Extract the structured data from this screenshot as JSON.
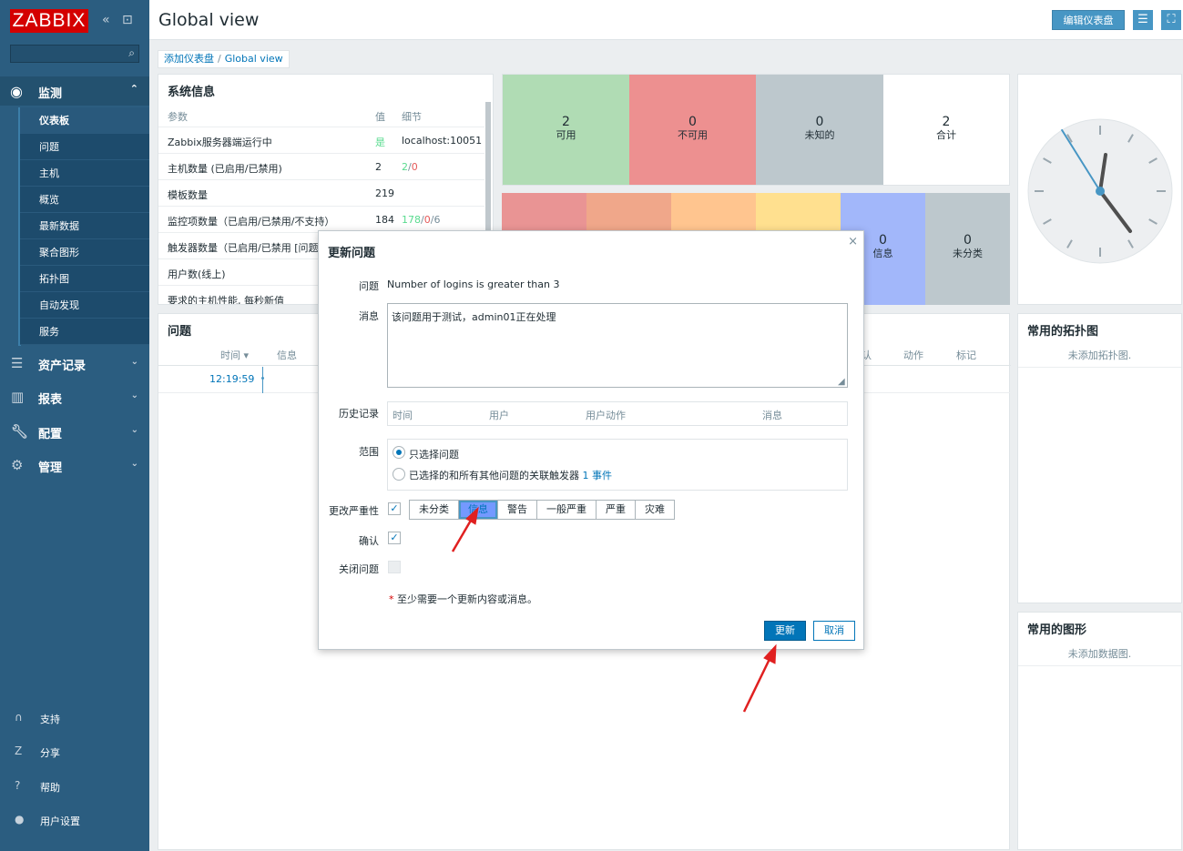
{
  "app": {
    "logo": "ZABBIX",
    "collapse_icon": "double-chevron-left-icon",
    "kiosk_icon": "kiosk-icon"
  },
  "sidebar": {
    "search_placeholder": "",
    "monitoring": {
      "label": "监测",
      "items": [
        "仪表板",
        "问题",
        "主机",
        "概览",
        "最新数据",
        "聚合图形",
        "拓扑图",
        "自动发现",
        "服务"
      ],
      "active": "仪表板"
    },
    "menus": [
      "资产记录",
      "报表",
      "配置",
      "管理"
    ],
    "bottom": [
      "支持",
      "分享",
      "帮助",
      "用户设置"
    ]
  },
  "header": {
    "title": "Global view",
    "edit_button": "编辑仪表盘",
    "colors": {
      "accent": "#4796c4"
    }
  },
  "breadcrumb": {
    "root": "添加仪表盘",
    "sep": "/",
    "current": "Global view"
  },
  "sysinfo": {
    "title": "系统信息",
    "cols": {
      "param": "参数",
      "value": "值",
      "detail": "细节"
    },
    "rows": [
      {
        "param": "Zabbix服务器端运行中",
        "value": "是",
        "detail": "localhost:10051"
      },
      {
        "param": "主机数量 (已启用/已禁用)",
        "value": "2",
        "d1": "2",
        "sep1": "/",
        "d2": "0"
      },
      {
        "param": "模板数量",
        "value": "219"
      },
      {
        "param": "监控项数量（已启用/已禁用/不支持）",
        "value": "184",
        "d1": "178",
        "sep1": "/",
        "d2": "0",
        "sep2": "/",
        "d3": "6"
      },
      {
        "param": "触发器数量（已启用/已禁用 [问题"
      },
      {
        "param": "用户数(线上)"
      },
      {
        "param": "要求的主机性能, 每秒新值"
      }
    ]
  },
  "host_avail": [
    {
      "count": "2",
      "label": "可用",
      "color": "#b0dcb4"
    },
    {
      "count": "0",
      "label": "不可用",
      "color": "#ed9090"
    },
    {
      "count": "0",
      "label": "未知的",
      "color": "#bdc8cd"
    },
    {
      "count": "2",
      "label": "合计",
      "color": "#ffffff"
    }
  ],
  "severity_tiles": [
    {
      "count": "",
      "label": "",
      "color": "#e99494"
    },
    {
      "count": "",
      "label": "",
      "color": "#f0a78a"
    },
    {
      "count": "",
      "label": "",
      "color": "#ffc58f"
    },
    {
      "count": "",
      "label": "",
      "color": "#ffe08f"
    },
    {
      "count": "0",
      "label": "信息",
      "color": "#a2b7fa"
    },
    {
      "count": "0",
      "label": "未分类",
      "color": "#bdc8cd"
    }
  ],
  "problems": {
    "title": "问题",
    "cols": {
      "time": "时间 ▾",
      "info": "信息",
      "ack": "认",
      "actions": "动作",
      "tags": "标记"
    },
    "row_time": "12:19:59"
  },
  "maps": {
    "title": "常用的拓扑图",
    "empty": "未添加拓扑图."
  },
  "graphs": {
    "title": "常用的图形",
    "empty": "未添加数据图."
  },
  "modal": {
    "title": "更新问题",
    "problem_label": "问题",
    "problem_value": "Number of logins is greater than 3",
    "message_label": "消息",
    "message_value": "该问题用于测试，admin01正在处理",
    "history_label": "历史记录",
    "history_cols": [
      "时间",
      "用户",
      "用户动作",
      "消息"
    ],
    "scope_label": "范围",
    "scope_opt1": "只选择问题",
    "scope_opt2": "已选择的和所有其他问题的关联触发器",
    "scope_count": "1 事件",
    "severity_label": "更改严重性",
    "severities": [
      "未分类",
      "信息",
      "警告",
      "一般严重",
      "严重",
      "灾难"
    ],
    "selected_severity": "信息",
    "ack_label": "确认",
    "close_label": "关闭问题",
    "required_star": "*",
    "required_note": "至少需要一个更新内容或消息。",
    "update_button": "更新",
    "cancel_button": "取消"
  }
}
